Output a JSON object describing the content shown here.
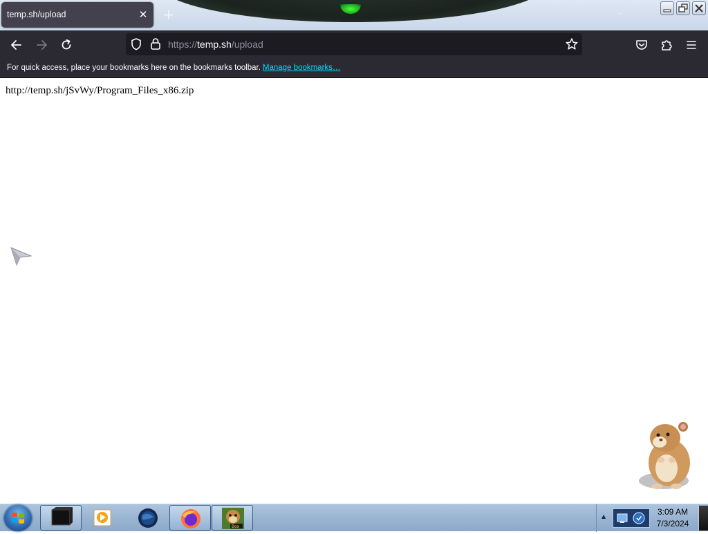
{
  "browser": {
    "tab": {
      "title": "temp.sh/upload"
    },
    "address": {
      "scheme": "https://",
      "host": "temp.sh",
      "path": "/upload"
    },
    "bookmarks_bar": {
      "message": "For quick access, place your bookmarks here on the bookmarks toolbar.",
      "link": "Manage bookmarks…"
    }
  },
  "page": {
    "text": "http://temp.sh/jSvWy/Program_Files_x86.zip"
  },
  "taskbar": {
    "clock_time": "3:09 AM",
    "clock_date": "7/3/2024"
  },
  "colors": {
    "toolbar": "#2b2a33",
    "urlbar": "#1c1b22",
    "tab": "#42414d",
    "link": "#00ddff",
    "taskbar": "#9ab5d3"
  },
  "icons": {
    "back": "arrow-left-icon",
    "forward": "arrow-right-icon",
    "reload": "reload-icon",
    "shield": "shield-icon",
    "lock": "lock-icon",
    "bookmark_star": "star-icon",
    "pocket": "pocket-icon",
    "extensions": "puzzle-icon",
    "menu": "hamburger-menu-icon"
  }
}
